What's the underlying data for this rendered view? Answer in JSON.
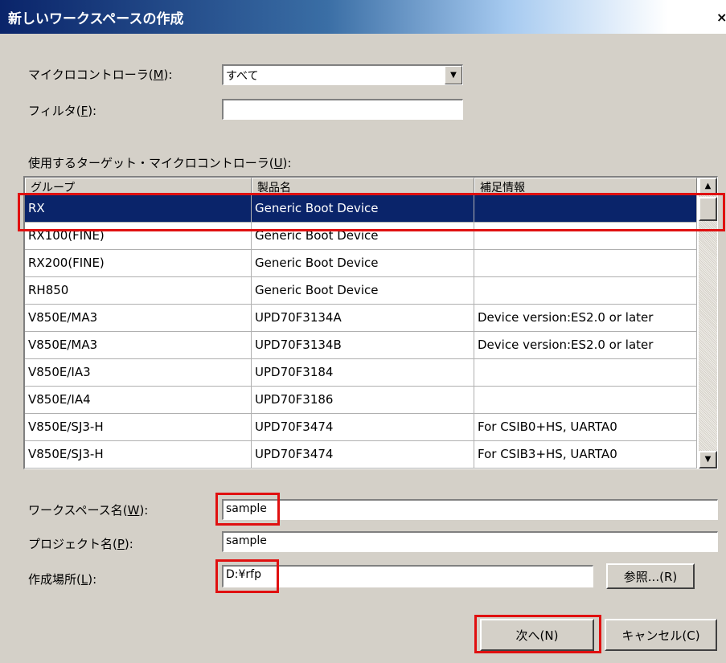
{
  "window": {
    "title": "新しいワークスペースの作成",
    "close_glyph": "×"
  },
  "microcontroller": {
    "label_prefix": "マイクロコントローラ(",
    "label_key": "M",
    "label_suffix": "):",
    "value": "すべて"
  },
  "filter": {
    "label_prefix": "フィルタ(",
    "label_key": "F",
    "label_suffix": "):",
    "value": ""
  },
  "target_list": {
    "label_prefix": "使用するターゲット・マイクロコントローラ(",
    "label_key": "U",
    "label_suffix": "):",
    "columns": [
      "グループ",
      "製品名",
      "補足情報"
    ],
    "rows": [
      {
        "group": "RX",
        "product": "Generic Boot Device",
        "info": ""
      },
      {
        "group": "RX100(FINE)",
        "product": "Generic Boot Device",
        "info": ""
      },
      {
        "group": "RX200(FINE)",
        "product": "Generic Boot Device",
        "info": ""
      },
      {
        "group": "RH850",
        "product": "Generic Boot Device",
        "info": ""
      },
      {
        "group": "V850E/MA3",
        "product": "UPD70F3134A",
        "info": "Device version:ES2.0 or later"
      },
      {
        "group": "V850E/MA3",
        "product": "UPD70F3134B",
        "info": "Device version:ES2.0 or later"
      },
      {
        "group": "V850E/IA3",
        "product": "UPD70F3184",
        "info": ""
      },
      {
        "group": "V850E/IA4",
        "product": "UPD70F3186",
        "info": ""
      },
      {
        "group": "V850E/SJ3-H",
        "product": "UPD70F3474",
        "info": "For CSIB0+HS, UARTA0"
      },
      {
        "group": "V850E/SJ3-H",
        "product": "UPD70F3474",
        "info": "For CSIB3+HS, UARTA0"
      }
    ]
  },
  "workspace": {
    "label_prefix": "ワークスペース名(",
    "label_key": "W",
    "label_suffix": "):",
    "value": "sample"
  },
  "project": {
    "label_prefix": "プロジェクト名(",
    "label_key": "P",
    "label_suffix": "):",
    "value": "sample"
  },
  "location": {
    "label_prefix": "作成場所(",
    "label_key": "L",
    "label_suffix": "):",
    "value": "D:¥rfp",
    "browse_label": "参照...(R)"
  },
  "buttons": {
    "next": "次へ(N)",
    "cancel": "キャンセル(C)"
  },
  "colors": {
    "highlight": "#e01010",
    "selection": "#0a246a",
    "dialog_bg": "#d4d0c8"
  }
}
